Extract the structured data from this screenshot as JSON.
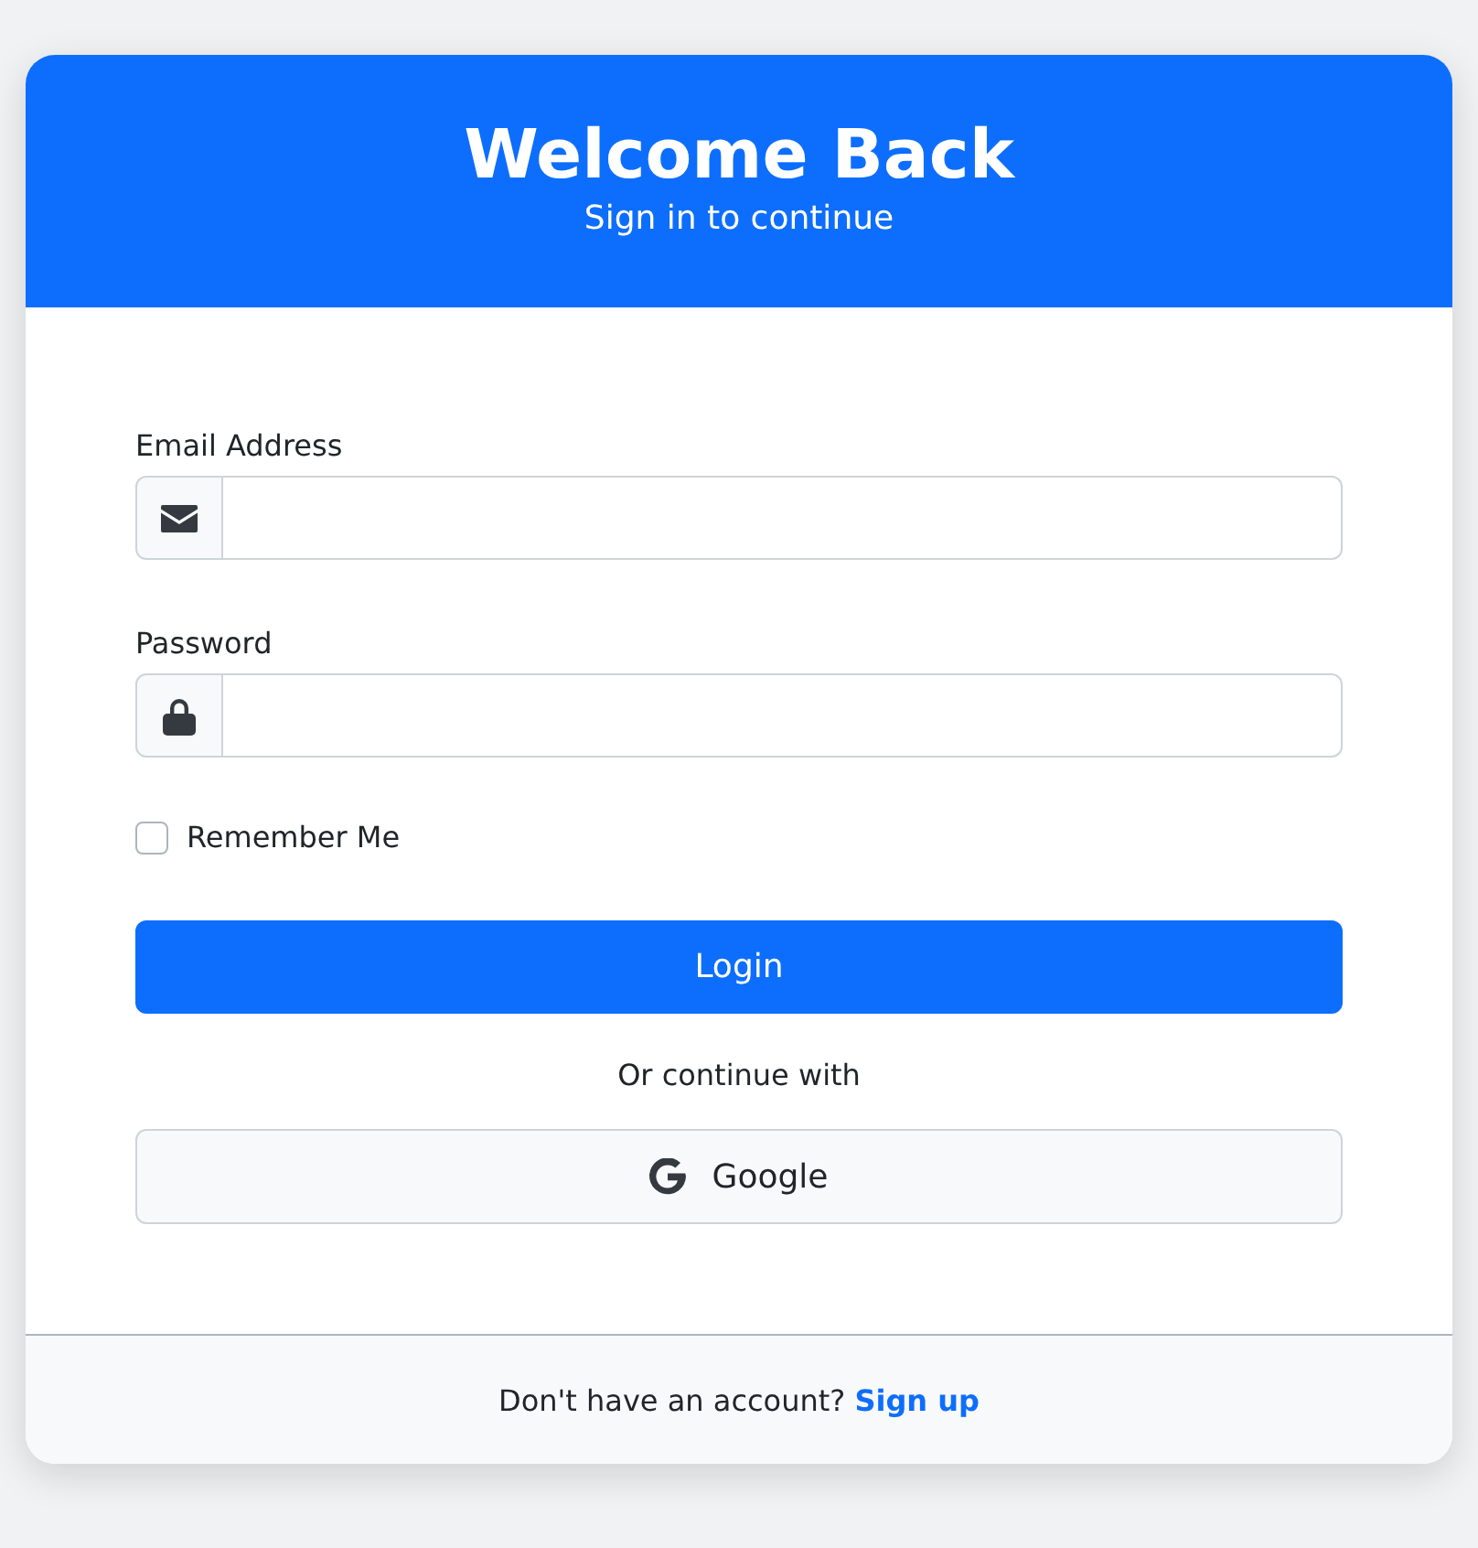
{
  "header": {
    "title": "Welcome Back",
    "subtitle": "Sign in to continue"
  },
  "fields": [
    {
      "kind": "email",
      "label": "Email Address"
    },
    {
      "kind": "password",
      "label": "Password"
    }
  ],
  "remember": {
    "label": "Remember Me",
    "checked": false
  },
  "login_button": "Login",
  "divider_text": "Or continue with",
  "social_button": "Google",
  "footer": {
    "text": "Don't have an account?",
    "link": "Sign up"
  }
}
